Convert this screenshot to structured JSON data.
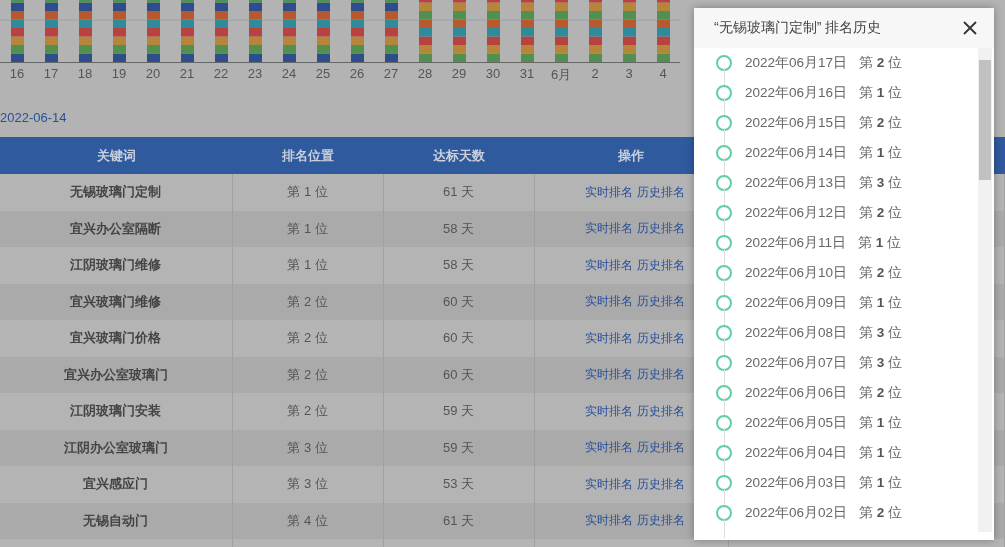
{
  "chart": {
    "x_labels": [
      "16",
      "17",
      "18",
      "19",
      "20",
      "21",
      "22",
      "23",
      "24",
      "25",
      "26",
      "27",
      "28",
      "29",
      "30",
      "31",
      "6月",
      "2",
      "3",
      "4"
    ]
  },
  "date_link": "2022-06-14",
  "table": {
    "columns": [
      "关键词",
      "排名位置",
      "达标天数",
      "操作"
    ],
    "rows": [
      {
        "keyword": "无锡玻璃门定制",
        "rank": "第 1 位",
        "days": "61 天",
        "actions": [
          "实时排名",
          "历史排名"
        ]
      },
      {
        "keyword": "宜兴办公室隔断",
        "rank": "第 1 位",
        "days": "58 天",
        "actions": [
          "实时排名",
          "历史排名"
        ]
      },
      {
        "keyword": "江阴玻璃门维修",
        "rank": "第 1 位",
        "days": "58 天",
        "actions": [
          "实时排名",
          "历史排名"
        ]
      },
      {
        "keyword": "宜兴玻璃门维修",
        "rank": "第 2 位",
        "days": "60 天",
        "actions": [
          "实时排名",
          "历史排名"
        ]
      },
      {
        "keyword": "宜兴玻璃门价格",
        "rank": "第 2 位",
        "days": "60 天",
        "actions": [
          "实时排名",
          "历史排名"
        ]
      },
      {
        "keyword": "宜兴办公室玻璃门",
        "rank": "第 2 位",
        "days": "60 天",
        "actions": [
          "实时排名",
          "历史排名"
        ]
      },
      {
        "keyword": "江阴玻璃门安装",
        "rank": "第 2 位",
        "days": "59 天",
        "actions": [
          "实时排名",
          "历史排名"
        ]
      },
      {
        "keyword": "江阴办公室玻璃门",
        "rank": "第 3 位",
        "days": "59 天",
        "actions": [
          "实时排名",
          "历史排名"
        ]
      },
      {
        "keyword": "宜兴感应门",
        "rank": "第 3 位",
        "days": "53 天",
        "actions": [
          "实时排名",
          "历史排名"
        ]
      },
      {
        "keyword": "无锡自动门",
        "rank": "第 4 位",
        "days": "61 天",
        "actions": [
          "实时排名",
          "历史排名"
        ]
      }
    ]
  },
  "dialog": {
    "title": "“无锡玻璃门定制” 排名历史",
    "history": [
      {
        "date": "2022年06月17日",
        "rank": "第 **2** 位"
      },
      {
        "date": "2022年06月16日",
        "rank": "第 **1** 位"
      },
      {
        "date": "2022年06月15日",
        "rank": "第 **2** 位"
      },
      {
        "date": "2022年06月14日",
        "rank": "第 **1** 位"
      },
      {
        "date": "2022年06月13日",
        "rank": "第 **3** 位"
      },
      {
        "date": "2022年06月12日",
        "rank": "第 **2** 位"
      },
      {
        "date": "2022年06月11日",
        "rank": "第 **1** 位"
      },
      {
        "date": "2022年06月10日",
        "rank": "第 **2** 位"
      },
      {
        "date": "2022年06月09日",
        "rank": "第 **1** 位"
      },
      {
        "date": "2022年06月08日",
        "rank": "第 **3** 位"
      },
      {
        "date": "2022年06月07日",
        "rank": "第 **3** 位"
      },
      {
        "date": "2022年06月06日",
        "rank": "第 **2** 位"
      },
      {
        "date": "2022年06月05日",
        "rank": "第 **1** 位"
      },
      {
        "date": "2022年06月04日",
        "rank": "第 **1** 位"
      },
      {
        "date": "2022年06月03日",
        "rank": "第 **1** 位"
      },
      {
        "date": "2022年06月02日",
        "rank": "第 **2** 位"
      }
    ]
  }
}
